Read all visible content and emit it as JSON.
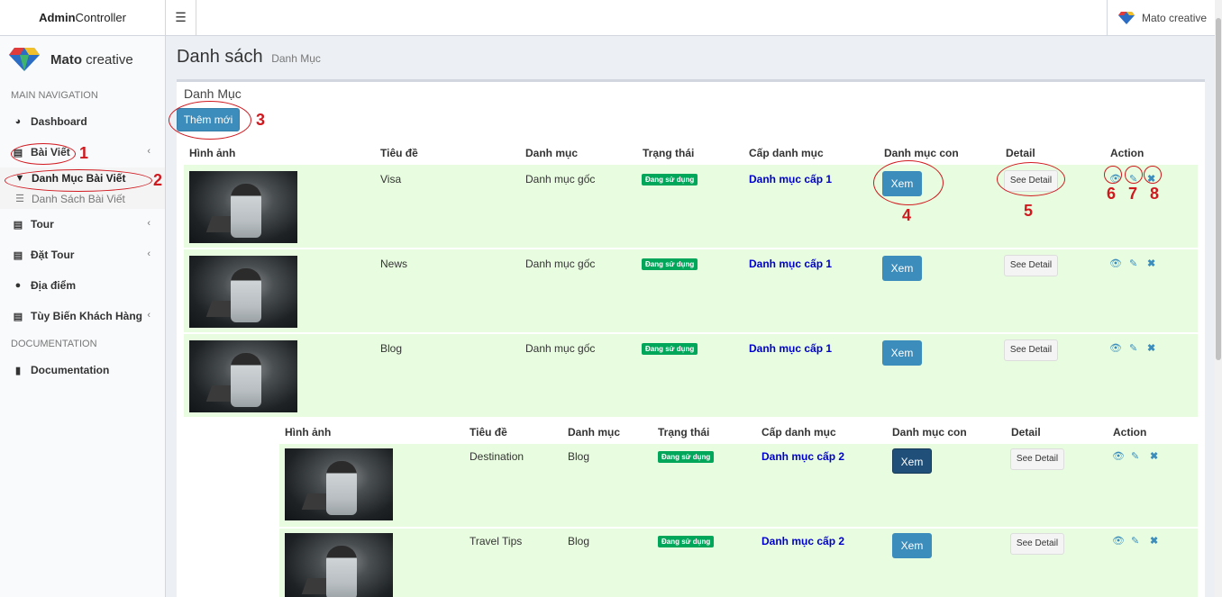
{
  "topbar": {
    "brand_bold": "Admin",
    "brand_rest": "Controller",
    "menu_icon": "☰",
    "user_name": "Mato creative"
  },
  "sidebar": {
    "brand_bold": "Mato",
    "brand_rest": "creative",
    "header_main": "MAIN NAVIGATION",
    "header_doc": "DOCUMENTATION",
    "items": [
      {
        "label": "Dashboard",
        "icon": "dashboard-icon"
      },
      {
        "label": "Bài Viết",
        "icon": "newspaper-icon"
      },
      {
        "label": "Tour",
        "icon": "newspaper-icon"
      },
      {
        "label": "Đặt Tour",
        "icon": "newspaper-icon"
      },
      {
        "label": "Địa điểm",
        "icon": "globe-icon"
      },
      {
        "label": "Tùy Biến Khách Hàng",
        "icon": "newspaper-icon"
      },
      {
        "label": "Documentation",
        "icon": "book-icon"
      }
    ],
    "sub": [
      {
        "label": "Danh Mục Bài Viết",
        "icon": "filter-icon"
      },
      {
        "label": "Danh Sách Bài Viết",
        "icon": "list-icon"
      }
    ]
  },
  "page": {
    "title": "Danh sách",
    "subtitle": "Danh Mục",
    "box_title": "Danh Mục",
    "add_button": "Thêm mới"
  },
  "table": {
    "headers": [
      "Hình ảnh",
      "Tiêu đề",
      "Danh mục",
      "Trạng thái",
      "Cấp danh mục",
      "Danh mục con",
      "Detail",
      "Action"
    ],
    "rows": [
      {
        "title": "Visa",
        "category": "Danh mục gốc",
        "status": "Đang sử dụng",
        "level": "Danh mục cấp 1",
        "sub": "Xem",
        "detail": "See Detail"
      },
      {
        "title": "News",
        "category": "Danh mục gốc",
        "status": "Đang sử dụng",
        "level": "Danh mục cấp 1",
        "sub": "Xem",
        "detail": "See Detail"
      },
      {
        "title": "Blog",
        "category": "Danh mục gốc",
        "status": "Đang sử dụng",
        "level": "Danh mục cấp 1",
        "sub": "Xem",
        "detail": "See Detail"
      }
    ]
  },
  "subtable": {
    "headers": [
      "Hình ảnh",
      "Tiêu đề",
      "Danh mục",
      "Trạng thái",
      "Cấp danh mục",
      "Danh mục con",
      "Detail",
      "Action"
    ],
    "rows": [
      {
        "title": "Destination",
        "category": "Blog",
        "status": "Đang sử dụng",
        "level": "Danh mục cấp 2",
        "sub": "Xem",
        "detail": "See Detail"
      },
      {
        "title": "Travel Tips",
        "category": "Blog",
        "status": "Đang sử dụng",
        "level": "Danh mục cấp 2",
        "sub": "Xem",
        "detail": "See Detail"
      }
    ]
  },
  "action_icons": {
    "view": "👁",
    "edit": "✎",
    "delete": "✖"
  },
  "annotations": [
    "1",
    "2",
    "3",
    "4",
    "5",
    "6",
    "7",
    "8"
  ],
  "colors": {
    "primary": "#3c8dbc",
    "success": "#00a65a",
    "row_bg": "#e8fde0",
    "annotation": "#d0191f",
    "link": "#0000cc"
  }
}
